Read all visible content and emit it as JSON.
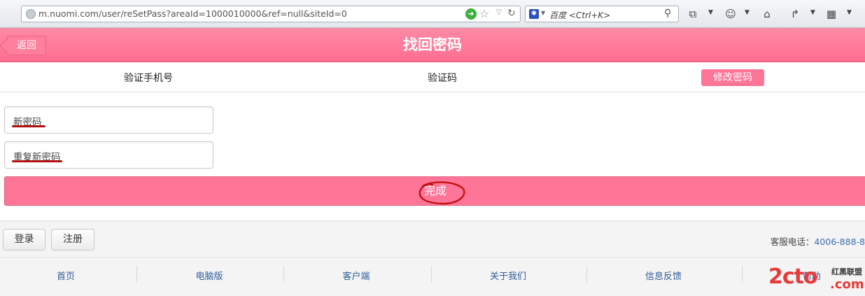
{
  "browser": {
    "url": "m.nuomi.com/user/reSetPass?areaId=1000010000&ref=null&siteId=0",
    "search_placeholder": "百度 <Ctrl+K>"
  },
  "header": {
    "back_label": "返回",
    "title": "找回密码"
  },
  "steps": [
    {
      "label": "验证手机号",
      "active": false
    },
    {
      "label": "验证码",
      "active": false
    },
    {
      "label": "修改密码",
      "active": true
    }
  ],
  "form": {
    "new_password_placeholder": "新密码",
    "repeat_password_placeholder": "重复新密码",
    "submit_label": "完成"
  },
  "account": {
    "login_label": "登录",
    "register_label": "注册",
    "hotline_label": "客服电话：",
    "hotline_number": "4006-888-8"
  },
  "footer": {
    "links": [
      "首页",
      "电脑版",
      "客户端",
      "关于我们",
      "信息反馈",
      "帮助"
    ]
  },
  "watermark": {
    "main": "2cto",
    "suffix": ".com",
    "cn": "红黑联盟"
  },
  "colors": {
    "brand_pink": "#ff7597",
    "link_blue": "#2f5b9a",
    "annotation_red": "#b01010"
  }
}
